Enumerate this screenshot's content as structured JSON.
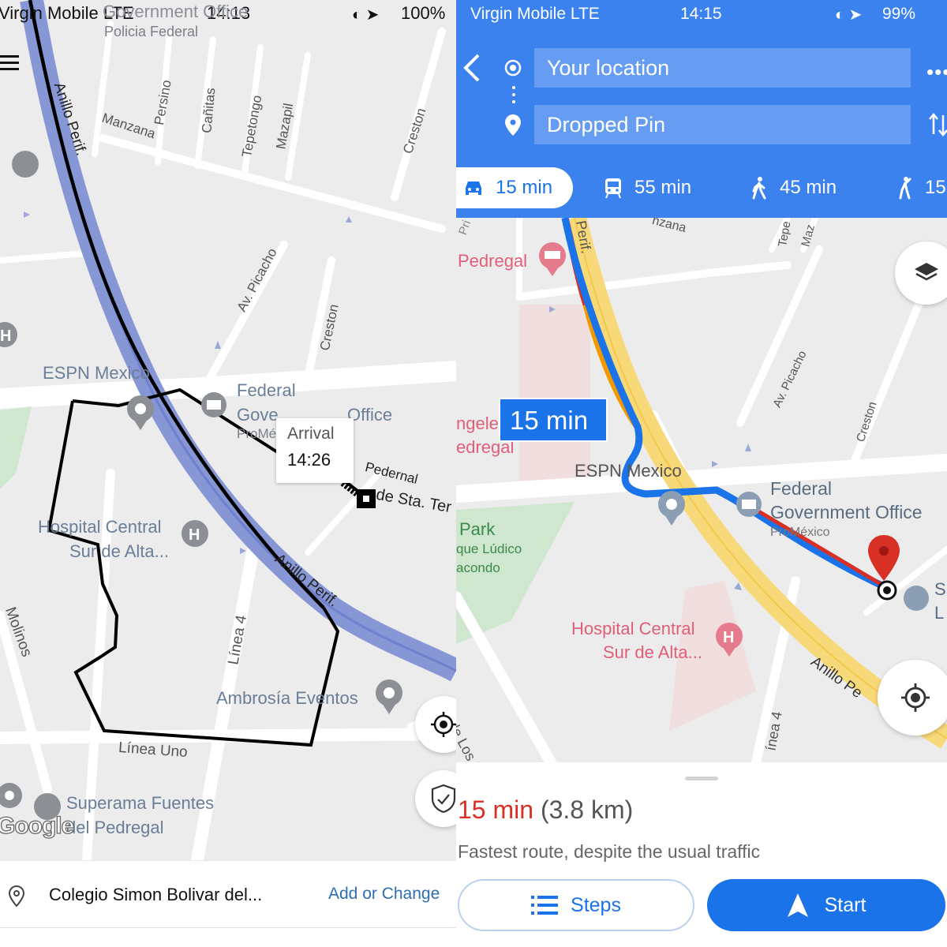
{
  "left": {
    "status": {
      "carrier": "Virgin Mobile  LTE",
      "time": "14:13",
      "battery": "100%"
    },
    "map_labels": {
      "gov_office_top": "Government Office",
      "policia": "Policia Federal",
      "persino": "Persino",
      "canitas": "Cañitas",
      "tepetongo": "Tepetongo",
      "mazapil": "Mazapil",
      "manzana": "Manzana",
      "creston1": "Creston",
      "creston2": "Creston",
      "picacho": "Av. Picacho",
      "anillo_top": "Anillo Perif.",
      "anillo_bottom": "Anillo Perif.",
      "espn": "ESPN Mexico",
      "federal": "Federal",
      "gove": "Gove",
      "office": "Office",
      "promexico": "ProMé",
      "pedernal": "Pedernal",
      "sta_ter": "de Sta. Ter",
      "hospital1": "Hospital Central",
      "hospital2": "Sur de Alta...",
      "linea4": "Línea 4",
      "ambrosia": "Ambrosía Eventos",
      "linea_uno": "Línea Uno",
      "molinos": "Molinos",
      "superama1": "Superama Fuentes",
      "superama2": "del Pedregal",
      "google": "Google"
    },
    "arrival": {
      "label": "Arrival",
      "time": "14:26"
    },
    "destination": "Colegio Simon Bolivar del...",
    "add_change": "Add or Change"
  },
  "right": {
    "status": {
      "carrier": "Virgin Mobile  LTE",
      "time": "14:15",
      "battery": "99%"
    },
    "origin": "Your location",
    "destination": "Dropped Pin",
    "modes": [
      {
        "icon": "car-icon",
        "label": "15 min"
      },
      {
        "icon": "train-icon",
        "label": "55 min"
      },
      {
        "icon": "walk-icon",
        "label": "45 min"
      },
      {
        "icon": "ride-icon",
        "label": "15"
      }
    ],
    "map_labels": {
      "pri": "Pri",
      "perif_top": "Perif.",
      "manzana": "nzana",
      "tepe": "Tepe",
      "maz": "Maz",
      "pedregal": "Pedregal",
      "picacho": "Av. Picacho",
      "creston": "Creston",
      "angele": "ngele",
      "edregal": "edregal",
      "espn": "ESPN Mexico",
      "federal": "Federal",
      "gov_office": "Government Office",
      "promexico": "ProMéxico",
      "s": "S",
      "l": "L",
      "park": "Park",
      "ludico": "que Lúdico",
      "macondo": "acondo",
      "hospital1": "Hospital Central",
      "hospital2": "Sur de Alta...",
      "fuente": "uente de Los Molinos",
      "linea4": "ínea 4",
      "anillo": "Anillo Pe"
    },
    "time_bubble": "15 min",
    "summary_time": "15 min",
    "summary_distance": "(3.8 km)",
    "summary_note": "Fastest route, despite the usual traffic",
    "steps_label": "Steps",
    "start_label": "Start",
    "colors": {
      "header": "#3b82ef",
      "route": "#1a73e8",
      "traffic_red": "#d93025",
      "traffic_orange": "#f29900"
    }
  }
}
